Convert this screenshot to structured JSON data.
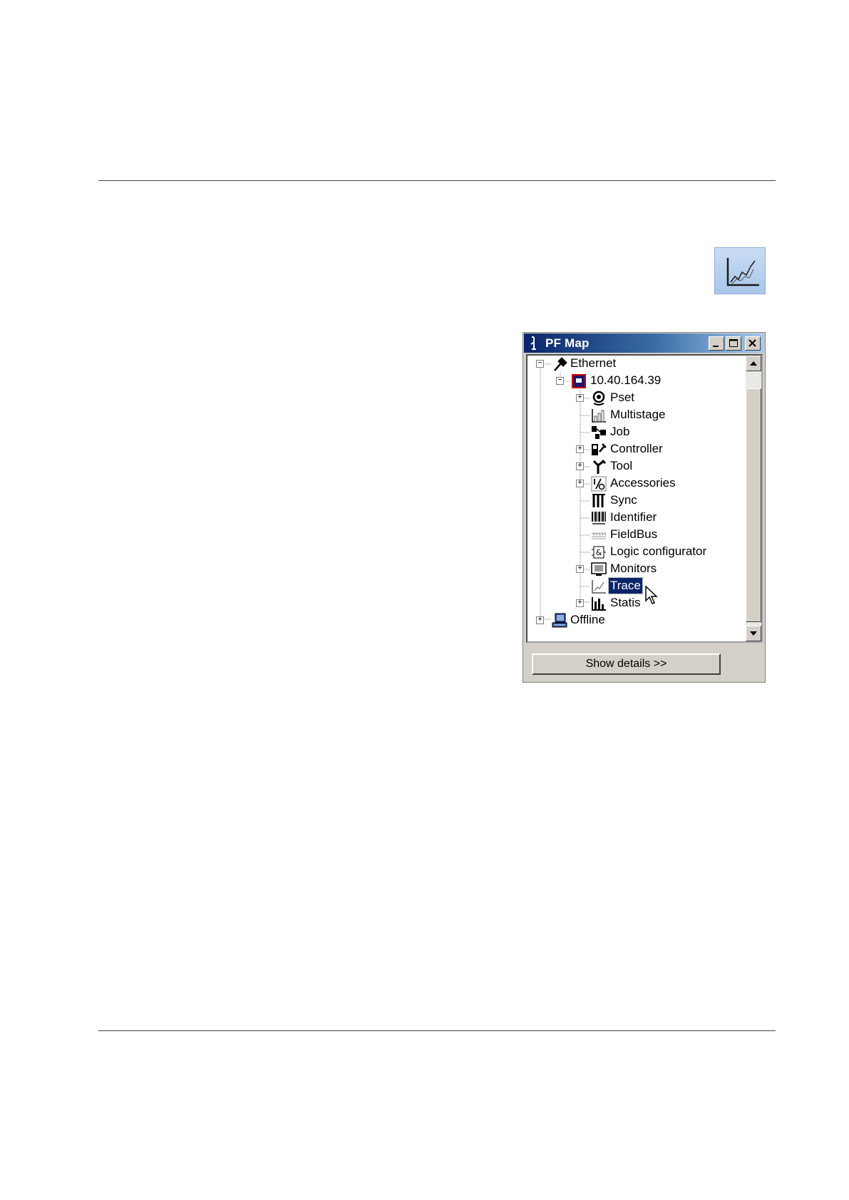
{
  "window": {
    "title": "PF Map",
    "show_details_label": "Show details >>"
  },
  "tree": {
    "root_ethernet": "Ethernet",
    "controller_ip": "10.40.164.39",
    "items": [
      {
        "label": "Pset",
        "icon": "pset-icon",
        "expandable": true
      },
      {
        "label": "Multistage",
        "icon": "multistage-icon",
        "expandable": false
      },
      {
        "label": "Job",
        "icon": "job-icon",
        "expandable": false
      },
      {
        "label": "Controller",
        "icon": "controller-icon",
        "expandable": true
      },
      {
        "label": "Tool",
        "icon": "tool-icon",
        "expandable": true
      },
      {
        "label": "Accessories",
        "icon": "accessories-icon",
        "expandable": true
      },
      {
        "label": "Sync",
        "icon": "sync-icon",
        "expandable": false
      },
      {
        "label": "Identifier",
        "icon": "barcode-icon",
        "expandable": false
      },
      {
        "label": "FieldBus",
        "icon": "fieldbus-icon",
        "expandable": false
      },
      {
        "label": "Logic configurator",
        "icon": "logic-icon",
        "expandable": false
      },
      {
        "label": "Monitors",
        "icon": "monitor-icon",
        "expandable": true
      },
      {
        "label": "Trace",
        "icon": "trace-icon",
        "expandable": false,
        "selected": true
      },
      {
        "label": "Statis",
        "icon": "statistics-icon",
        "expandable": true
      }
    ],
    "root_offline": "Offline"
  },
  "colors": {
    "selection": "#0a246a",
    "title_gradient_start": "#0a246a",
    "title_gradient_end": "#a6caf0",
    "controller_icon_border": "#cc0000"
  }
}
